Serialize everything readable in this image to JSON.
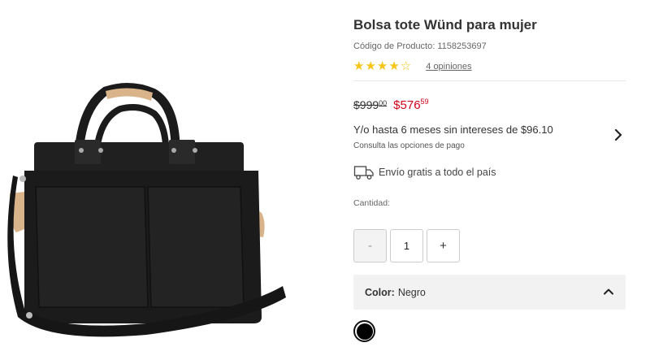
{
  "product": {
    "title": "Bolsa tote Wünd para mujer",
    "code": "Código de Producto: 1158253697",
    "rating": 4,
    "rating_max": 5,
    "reviews": "4 opiniones"
  },
  "price": {
    "old_main": "$999",
    "old_cents": "00",
    "new_main": "$576",
    "new_cents": "59",
    "installments": "Y/o hasta 6 meses sin intereses de $96.10",
    "payment_options": "Consulta las opciones de pago"
  },
  "shipping": {
    "text": "Envío gratis a todo el país",
    "icon": "truck-icon"
  },
  "quantity": {
    "label": "Cantidad:",
    "minus": "-",
    "value": "1",
    "plus": "+"
  },
  "color": {
    "label": "Color:",
    "value": "Negro",
    "swatches": [
      {
        "name": "Negro",
        "hex": "#000000"
      }
    ]
  },
  "colors": {
    "accent_price": "#d0021b",
    "star": "#f5c518",
    "bag": "#1b1b1b",
    "leather": "#d9b48a"
  }
}
